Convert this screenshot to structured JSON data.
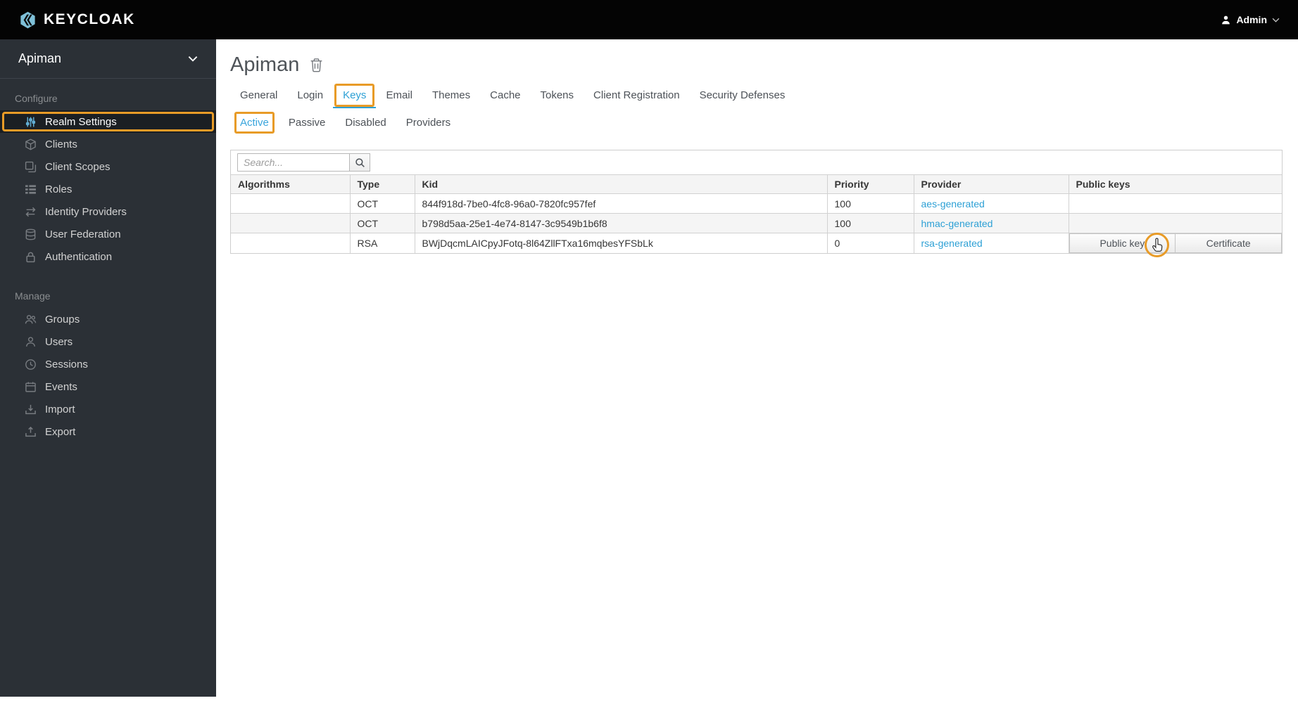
{
  "topbar": {
    "brand": "KEYCLOAK",
    "user_label": "Admin"
  },
  "sidebar": {
    "realm": "Apiman",
    "sections": [
      {
        "label": "Configure",
        "items": [
          {
            "label": "Realm Settings",
            "icon": "sliders-icon",
            "active": true,
            "annotated": true
          },
          {
            "label": "Clients",
            "icon": "cube-icon"
          },
          {
            "label": "Client Scopes",
            "icon": "clone-icon"
          },
          {
            "label": "Roles",
            "icon": "list-icon"
          },
          {
            "label": "Identity Providers",
            "icon": "exchange-icon"
          },
          {
            "label": "User Federation",
            "icon": "database-icon"
          },
          {
            "label": "Authentication",
            "icon": "lock-icon"
          }
        ]
      },
      {
        "label": "Manage",
        "items": [
          {
            "label": "Groups",
            "icon": "users-icon"
          },
          {
            "label": "Users",
            "icon": "user-icon"
          },
          {
            "label": "Sessions",
            "icon": "clock-icon"
          },
          {
            "label": "Events",
            "icon": "calendar-icon"
          },
          {
            "label": "Import",
            "icon": "import-icon"
          },
          {
            "label": "Export",
            "icon": "export-icon"
          }
        ]
      }
    ]
  },
  "main": {
    "title": "Apiman",
    "tabs": [
      {
        "label": "General"
      },
      {
        "label": "Login"
      },
      {
        "label": "Keys",
        "active": true,
        "annotated": true
      },
      {
        "label": "Email"
      },
      {
        "label": "Themes"
      },
      {
        "label": "Cache"
      },
      {
        "label": "Tokens"
      },
      {
        "label": "Client Registration"
      },
      {
        "label": "Security Defenses"
      }
    ],
    "subtabs": [
      {
        "label": "Active",
        "active": true,
        "annotated": true
      },
      {
        "label": "Passive"
      },
      {
        "label": "Disabled"
      },
      {
        "label": "Providers"
      }
    ],
    "search": {
      "placeholder": "Search..."
    },
    "table": {
      "columns": [
        "Algorithms",
        "Type",
        "Kid",
        "Priority",
        "Provider",
        "Public keys"
      ],
      "rows": [
        {
          "algorithms": "",
          "type": "OCT",
          "kid": "844f918d-7be0-4fc8-96a0-7820fc957fef",
          "priority": "100",
          "provider": "aes-generated",
          "public_keys": []
        },
        {
          "algorithms": "",
          "type": "OCT",
          "kid": "b798d5aa-25e1-4e74-8147-3c9549b1b6f8",
          "priority": "100",
          "provider": "hmac-generated",
          "public_keys": []
        },
        {
          "algorithms": "",
          "type": "RSA",
          "kid": "BWjDqcmLAICpyJFotq-8l64ZllFTxa16mqbesYFSbLk",
          "priority": "0",
          "provider": "rsa-generated",
          "public_keys": [
            "Public key",
            "Certificate"
          ]
        }
      ]
    }
  },
  "colors": {
    "annotation_orange": "#e89b27",
    "link_blue": "#2da0d5",
    "active_subtab_blue": "#39a5dc",
    "topbar_black": "#040404",
    "sidebar_dark": "#2b3036"
  }
}
